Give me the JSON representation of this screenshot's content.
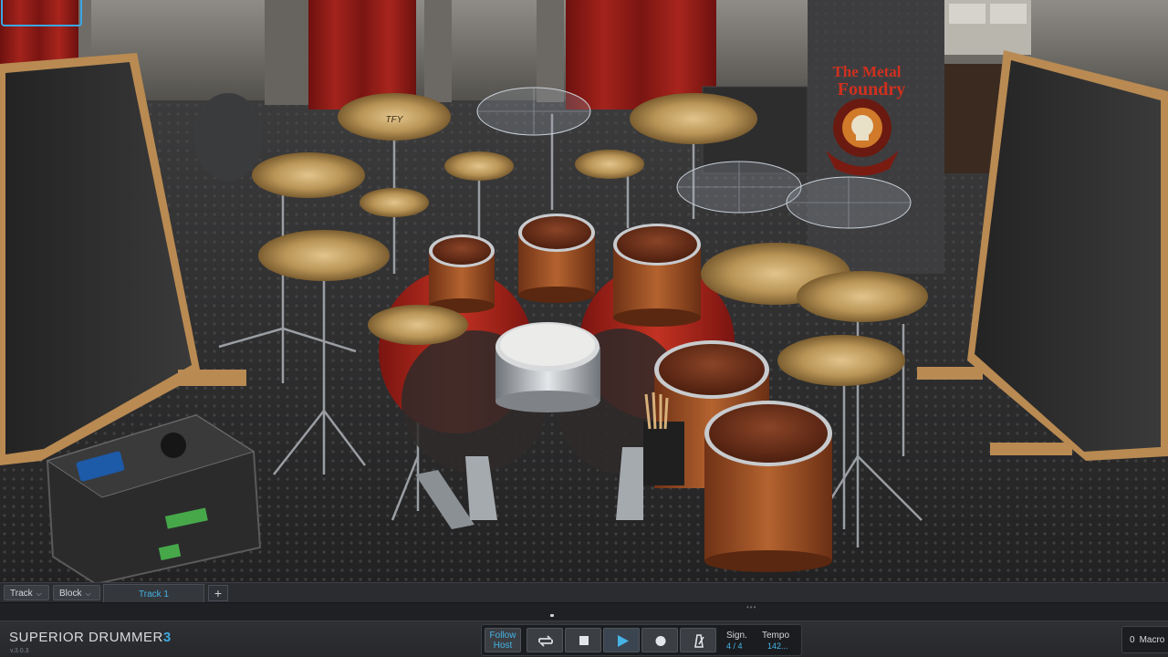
{
  "app": {
    "logo_word1": "SUPERIOR",
    "logo_word2": "DRUMMER",
    "logo_word3": "3",
    "version": "v.3.0.3"
  },
  "stage": {
    "banner_line1": "The Metal",
    "banner_line2": "Foundry",
    "cymbal_logo": "TFY"
  },
  "track_bar": {
    "track_label": "Track",
    "block_label": "Block",
    "active_tab": "Track 1",
    "add_label": "+"
  },
  "transport": {
    "follow_host_line1": "Follow",
    "follow_host_line2": "Host",
    "sign_label": "Sign.",
    "sign_value": "4 / 4",
    "tempo_label": "Tempo",
    "tempo_value": "142..."
  },
  "macro": {
    "count": "0",
    "label": "Macro"
  },
  "colors": {
    "accent": "#45b3e6",
    "panel": "#2a2c30",
    "curtain": "#8e1a16",
    "drum_shell": "#a4552a",
    "cymbal": "#b08a4e"
  }
}
